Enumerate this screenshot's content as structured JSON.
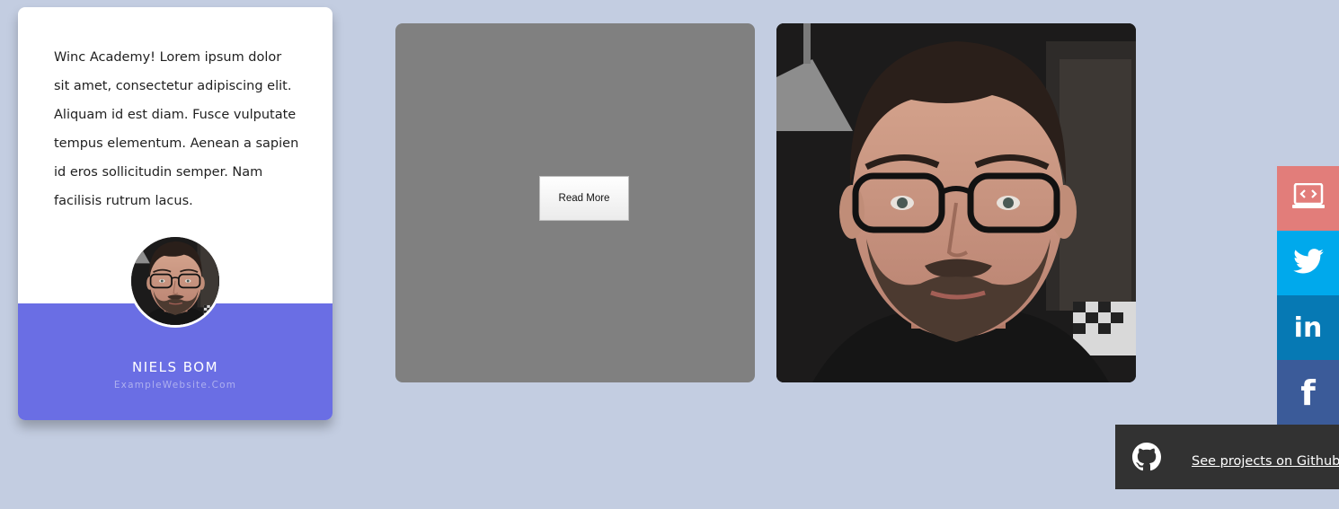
{
  "profile_card": {
    "bio": "Winc Academy! Lorem ipsum dolor sit amet, consectetur adipiscing elit. Aliquam id est diam. Fusce vulputate tempus elementum. Aenean a sapien id eros sollicitudin semper. Nam facilisis rutrum lacus.",
    "name": "NIELS BOM",
    "website": "ExampleWebsite.Com"
  },
  "tile": {
    "button_label": "Read More"
  },
  "social": {
    "items": [
      {
        "name": "portfolio",
        "icon": "laptop-code-icon",
        "color": "#e27d7a"
      },
      {
        "name": "twitter",
        "icon": "twitter-icon",
        "color": "#00a9ec"
      },
      {
        "name": "linkedin",
        "icon": "linkedin-icon",
        "glyph": "in",
        "color": "#0679b4"
      },
      {
        "name": "facebook",
        "icon": "facebook-icon",
        "glyph": "f",
        "color": "#3b5b99"
      }
    ]
  },
  "github": {
    "icon": "github-icon",
    "link_label": "See projects on Github"
  },
  "colors": {
    "background": "#c3cde1",
    "card_footer": "#6a6ee4",
    "tile_gray": "#808080",
    "github_bar": "#323232"
  }
}
